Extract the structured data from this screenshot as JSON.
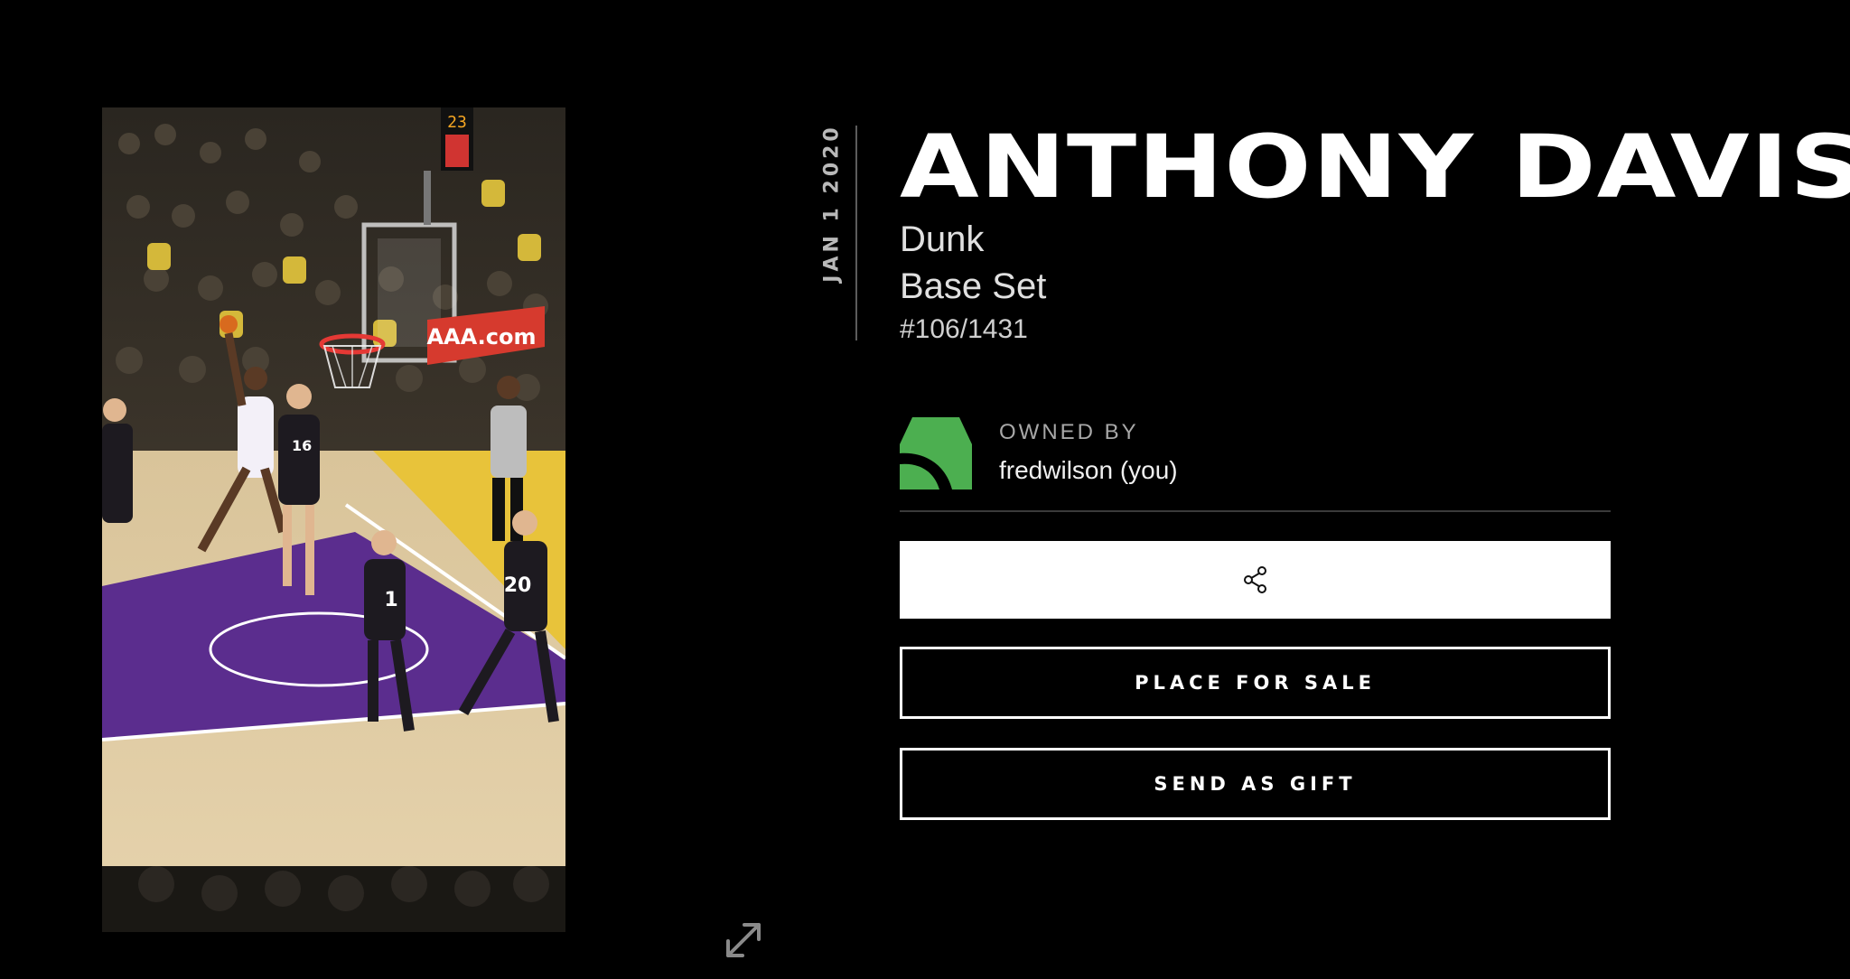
{
  "moment": {
    "date": "JAN 1 2020",
    "player_name": "ANTHONY DAVIS",
    "play_type": "Dunk",
    "set_name": "Base Set",
    "serial": "#106/1431"
  },
  "owner": {
    "label": "OWNED BY",
    "name": "fredwilson (you)",
    "avatar_color": "#4caf50"
  },
  "actions": {
    "share_icon": "share-icon",
    "place_for_sale_label": "PLACE FOR SALE",
    "send_as_gift_label": "SEND AS GIFT"
  },
  "video": {
    "ad_board_text": "AAA.com",
    "shot_clock": "23",
    "jersey_numbers": [
      "16",
      "1",
      "20"
    ]
  },
  "colors": {
    "background": "#000000",
    "court_purple": "#5b2d8e",
    "court_gold": "#e8c33a"
  }
}
